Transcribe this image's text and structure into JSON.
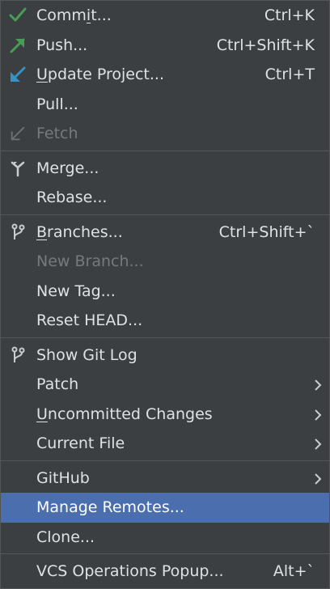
{
  "menu": {
    "commit": {
      "prefix": "Comm",
      "mnemonic": "i",
      "suffix": "t...",
      "shortcut": "Ctrl+K",
      "icon": "checkmark-icon"
    },
    "push": {
      "label": "Push...",
      "shortcut": "Ctrl+Shift+K",
      "icon": "push-arrow-icon"
    },
    "update": {
      "mnemonic": "U",
      "suffix": "pdate Project...",
      "shortcut": "Ctrl+T",
      "icon": "update-arrow-icon"
    },
    "pull": {
      "label": "Pull..."
    },
    "fetch": {
      "label": "Fetch",
      "icon": "fetch-arrow-icon"
    },
    "merge": {
      "label": "Merge...",
      "icon": "merge-icon"
    },
    "rebase": {
      "label": "Rebase..."
    },
    "branches": {
      "mnemonic": "B",
      "suffix": "ranches...",
      "shortcut": "Ctrl+Shift+`",
      "icon": "branch-icon"
    },
    "new_branch": {
      "label": "New Branch..."
    },
    "new_tag": {
      "label": "New Tag..."
    },
    "reset_head": {
      "label": "Reset HEAD..."
    },
    "show_git_log": {
      "label": "Show Git Log",
      "icon": "git-log-branch-icon"
    },
    "patch": {
      "label": "Patch"
    },
    "uncommitted": {
      "mnemonic": "U",
      "suffix": "ncommitted Changes"
    },
    "current_file": {
      "label": "Current File"
    },
    "github": {
      "label": "GitHub"
    },
    "manage_remotes": {
      "label": "Manage Remotes..."
    },
    "clone": {
      "label": "Clone..."
    },
    "vcs_popup": {
      "label": "VCS Operations Popup...",
      "shortcut": "Alt+`"
    }
  },
  "colors": {
    "background": "#3c3f41",
    "selected": "#4b6eaf",
    "text": "#dfe1e5",
    "disabled": "#77797c",
    "commit_green": "#499c54",
    "push_green": "#499c54",
    "update_blue": "#3592c4"
  }
}
